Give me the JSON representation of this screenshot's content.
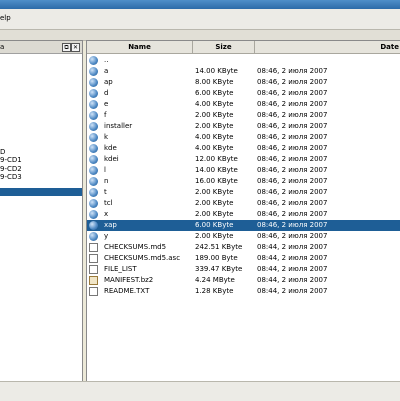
{
  "menubar": {
    "help_label": "elp"
  },
  "left_pane": {
    "title": "a",
    "float_glyph": "⧉",
    "close_glyph": "✕",
    "tree_items": [
      {
        "label": "D"
      },
      {
        "label": "9-CD1"
      },
      {
        "label": "9-CD2"
      },
      {
        "label": "9-CD3"
      }
    ]
  },
  "file_list": {
    "columns": {
      "name": "Name",
      "size": "Size",
      "date": "Date"
    },
    "rows": [
      {
        "name": "..",
        "size": "",
        "date": "",
        "icon": "folder-icon"
      },
      {
        "name": "a",
        "size": "14.00 KByte",
        "date": "08:46, 2 июля 2007",
        "icon": "folder-icon"
      },
      {
        "name": "ap",
        "size": "8.00 KByte",
        "date": "08:46, 2 июля 2007",
        "icon": "folder-icon"
      },
      {
        "name": "d",
        "size": "6.00 KByte",
        "date": "08:46, 2 июля 2007",
        "icon": "folder-icon"
      },
      {
        "name": "e",
        "size": "4.00 KByte",
        "date": "08:46, 2 июля 2007",
        "icon": "folder-icon"
      },
      {
        "name": "f",
        "size": "2.00 KByte",
        "date": "08:46, 2 июля 2007",
        "icon": "folder-icon"
      },
      {
        "name": "installer",
        "size": "2.00 KByte",
        "date": "08:46, 2 июля 2007",
        "icon": "folder-icon"
      },
      {
        "name": "k",
        "size": "4.00 KByte",
        "date": "08:46, 2 июля 2007",
        "icon": "folder-icon"
      },
      {
        "name": "kde",
        "size": "4.00 KByte",
        "date": "08:46, 2 июля 2007",
        "icon": "folder-icon"
      },
      {
        "name": "kdei",
        "size": "12.00 KByte",
        "date": "08:46, 2 июля 2007",
        "icon": "folder-icon"
      },
      {
        "name": "l",
        "size": "14.00 KByte",
        "date": "08:46, 2 июля 2007",
        "icon": "folder-icon"
      },
      {
        "name": "n",
        "size": "16.00 KByte",
        "date": "08:46, 2 июля 2007",
        "icon": "folder-icon"
      },
      {
        "name": "t",
        "size": "2.00 KByte",
        "date": "08:46, 2 июля 2007",
        "icon": "folder-icon"
      },
      {
        "name": "tcl",
        "size": "2.00 KByte",
        "date": "08:46, 2 июля 2007",
        "icon": "folder-icon"
      },
      {
        "name": "x",
        "size": "2.00 KByte",
        "date": "08:46, 2 июля 2007",
        "icon": "folder-icon"
      },
      {
        "name": "xap",
        "size": "6.00 KByte",
        "date": "08:46, 2 июля 2007",
        "icon": "folder-icon",
        "selected": true
      },
      {
        "name": "y",
        "size": "2.00 KByte",
        "date": "08:46, 2 июля 2007",
        "icon": "folder-icon"
      },
      {
        "name": "CHECKSUMS.md5",
        "size": "242.51 KByte",
        "date": "08:44, 2 июля 2007",
        "icon": "document-icon"
      },
      {
        "name": "CHECKSUMS.md5.asc",
        "size": "189.00 Byte",
        "date": "08:44, 2 июля 2007",
        "icon": "document-icon"
      },
      {
        "name": "FILE_LIST",
        "size": "339.47 KByte",
        "date": "08:44, 2 июля 2007",
        "icon": "document-icon"
      },
      {
        "name": "MANIFEST.bz2",
        "size": "4.24 MByte",
        "date": "08:44, 2 июля 2007",
        "icon": "archive-icon"
      },
      {
        "name": "README.TXT",
        "size": "1.28 KByte",
        "date": "08:44, 2 июля 2007",
        "icon": "document-icon"
      }
    ]
  }
}
